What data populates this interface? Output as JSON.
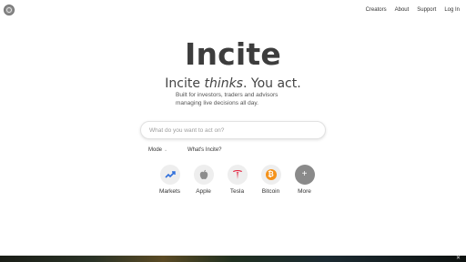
{
  "nav": {
    "links": [
      "Creators",
      "About",
      "Support",
      "Log In"
    ]
  },
  "hero": {
    "title": "Incite",
    "tagline_start": "Incite ",
    "tagline_emph": "thinks",
    "tagline_end": ". You act.",
    "description": "Built for investors, traders and advisors managing live decisions all day."
  },
  "search": {
    "placeholder": "What do you want to act on?"
  },
  "options": {
    "mode_label": "Mode",
    "whats_label": "What's Incite?"
  },
  "quick_actions": [
    {
      "label": "Markets",
      "icon": "markets-chart-icon"
    },
    {
      "label": "Apple",
      "icon": "apple-icon"
    },
    {
      "label": "Tesla",
      "icon": "tesla-icon"
    },
    {
      "label": "Bitcoin",
      "icon": "bitcoin-icon",
      "glyph": "₿"
    },
    {
      "label": "More",
      "icon": "plus-icon",
      "glyph": "+"
    }
  ],
  "colors": {
    "tesla_red": "#e31937",
    "bitcoin_orange": "#f4921b",
    "markets_blue": "#2f6fdb"
  }
}
